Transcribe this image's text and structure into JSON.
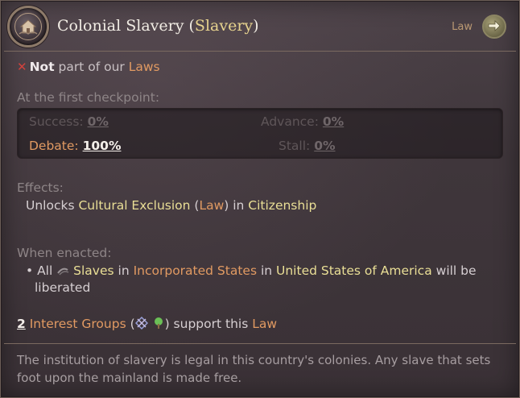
{
  "header": {
    "title_main": "Colonial Slavery (",
    "title_group": "Slavery",
    "title_close": ")",
    "law_tag": "Law",
    "emblem_icon": "house-chain-icon",
    "arrow_icon": "arrow-right-icon"
  },
  "status": {
    "not_label": "Not",
    "rest": " part of our ",
    "link": "Laws"
  },
  "checkpoint": {
    "heading": "At the first checkpoint:",
    "success_label": "Success:",
    "success_value": "0%",
    "advance_label": "Advance:",
    "advance_value": "0%",
    "debate_label": "Debate:",
    "debate_value": "100%",
    "stall_label": "Stall:",
    "stall_value": "0%"
  },
  "effects": {
    "heading": "Effects:",
    "prefix": "Unlocks ",
    "law_name": "Cultural Exclusion",
    "paren_open": " (",
    "law_word": "Law",
    "paren_close": ") in ",
    "group": "Citizenship"
  },
  "enacted": {
    "heading": "When enacted:",
    "bullet": "• All ",
    "slaves": "Slaves",
    "in1": " in ",
    "states": "Incorporated States",
    "in2": " in ",
    "country": "United States of America",
    "tail": " will be",
    "line2": "liberated"
  },
  "interest_groups": {
    "count": "2",
    "label": "Interest Groups",
    "open": " (",
    "close": ") support this ",
    "law_word": "Law"
  },
  "flavor_text": "The institution of slavery is legal in this country's colonies. Any slave that sets foot upon the mainland is made free.",
  "colors": {
    "accent_orange": "#e19a62",
    "accent_yellow": "#eadf96",
    "negative_red": "#d0423d"
  }
}
